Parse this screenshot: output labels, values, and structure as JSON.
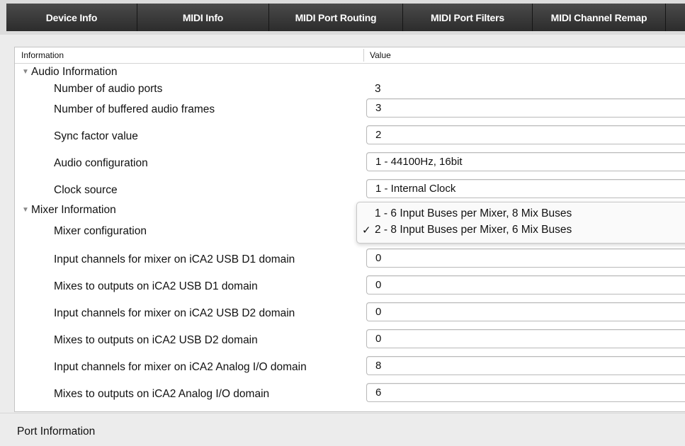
{
  "tabs": [
    "Device Info",
    "MIDI Info",
    "MIDI Port Routing",
    "MIDI Port Filters",
    "MIDI Channel Remap",
    ""
  ],
  "table": {
    "col_information": "Information",
    "col_value": "Value"
  },
  "audio": {
    "group_label": "Audio Information",
    "num_ports_label": "Number of audio ports",
    "num_ports_value": "3",
    "buffered_frames_label": "Number of buffered audio frames",
    "buffered_frames_value": "3",
    "sync_factor_label": "Sync factor value",
    "sync_factor_value": "2",
    "audio_config_label": "Audio configuration",
    "audio_config_value": "1 - 44100Hz, 16bit",
    "clock_source_label": "Clock source",
    "clock_source_value": "1 - Internal Clock"
  },
  "mixer": {
    "group_label": "Mixer Information",
    "config_label": "Mixer configuration",
    "config_options": [
      "1 - 6 Input Buses per Mixer, 8 Mix Buses",
      "2 - 8 Input Buses per Mixer, 6 Mix Buses"
    ],
    "config_selected_mark": "✓",
    "usb_d1_in_label": "Input channels for mixer on iCA2 USB D1 domain",
    "usb_d1_in_value": "0",
    "usb_d1_out_label": "Mixes to outputs on iCA2 USB D1 domain",
    "usb_d1_out_value": "0",
    "usb_d2_in_label": "Input channels for mixer on iCA2 USB D2 domain",
    "usb_d2_in_value": "0",
    "usb_d2_out_label": "Mixes to outputs on iCA2 USB D2 domain",
    "usb_d2_out_value": "0",
    "analog_in_label": "Input channels for mixer on iCA2 Analog I/O domain",
    "analog_in_value": "8",
    "analog_out_label": "Mixes to outputs on iCA2 Analog I/O domain",
    "analog_out_value": "6"
  },
  "footer": {
    "port_info_label": "Port Information"
  }
}
